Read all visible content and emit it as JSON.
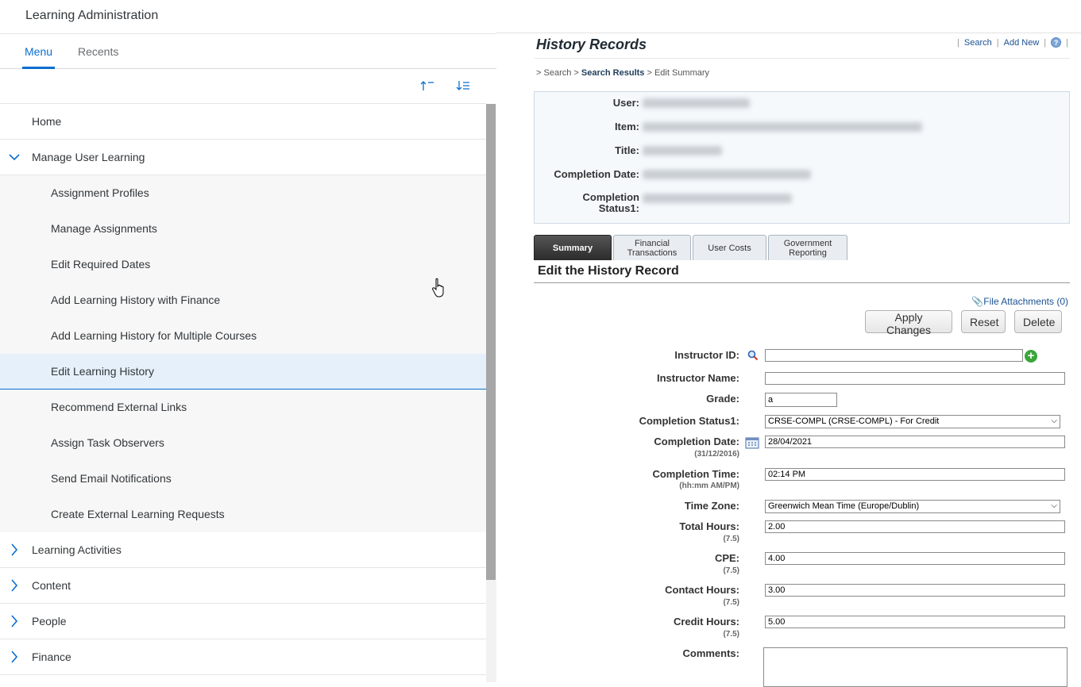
{
  "app": {
    "title": "Learning Administration"
  },
  "tabs": {
    "menu": "Menu",
    "recents": "Recents"
  },
  "toolbar": {
    "sort_asc_icon": "sort-ascending-icon",
    "sort_desc_icon": "sort-descending-icon"
  },
  "menu": {
    "home": "Home",
    "manage_user_learning": "Manage User Learning",
    "sub": [
      "Assignment Profiles",
      "Manage Assignments",
      "Edit Required Dates",
      "Add Learning History with Finance",
      "Add Learning History for Multiple Courses",
      "Edit Learning History",
      "Recommend External Links",
      "Assign Task Observers",
      "Send Email Notifications",
      "Create External Learning Requests"
    ],
    "selected": "Edit Learning History",
    "learning_activities": "Learning Activities",
    "content": "Content",
    "people": "People",
    "finance": "Finance"
  },
  "history": {
    "title": "History Records",
    "links": {
      "search": "Search",
      "add_new": "Add New",
      "help": "?"
    },
    "breadcrumb": {
      "sep": ">",
      "search": "Search",
      "results": "Search Results",
      "current": "Edit Summary"
    },
    "summary": {
      "user_label": "User:",
      "item_label": "Item:",
      "title_label": "Title:",
      "completion_date_label": "Completion Date:",
      "completion_status_label_1": "Completion",
      "completion_status_label_2": "Status1:"
    },
    "tabs": {
      "summary": "Summary",
      "financial_1": "Financial",
      "financial_2": "Transactions",
      "user_costs": "User Costs",
      "government_1": "Government",
      "government_2": "Reporting"
    },
    "section_title": "Edit the History Record",
    "file_attachments": "File Attachments (0)",
    "buttons": {
      "apply": "Apply Changes",
      "reset": "Reset",
      "delete": "Delete"
    },
    "form": {
      "instructor_id_label": "Instructor ID:",
      "instructor_id_value": "",
      "instructor_name_label": "Instructor Name:",
      "instructor_name_value": "",
      "grade_label": "Grade:",
      "grade_value": "a",
      "completion_status_label": "Completion Status1:",
      "completion_status_value": "CRSE-COMPL (CRSE-COMPL) - For Credit",
      "completion_date_label": "Completion Date:",
      "completion_date_hint": "(31/12/2016)",
      "completion_date_value": "28/04/2021",
      "completion_time_label": "Completion Time:",
      "completion_time_hint": "(hh:mm AM/PM)",
      "completion_time_value": "02:14 PM",
      "time_zone_label": "Time Zone:",
      "time_zone_value": "Greenwich Mean Time (Europe/Dublin)",
      "total_hours_label": "Total Hours:",
      "total_hours_hint": "(7.5)",
      "total_hours_value": "2.00",
      "cpe_label": "CPE:",
      "cpe_hint": "(7.5)",
      "cpe_value": "4.00",
      "contact_hours_label": "Contact Hours:",
      "contact_hours_hint": "(7.5)",
      "contact_hours_value": "3.00",
      "credit_hours_label": "Credit Hours:",
      "credit_hours_hint": "(7.5)",
      "credit_hours_value": "5.00",
      "comments_label": "Comments:"
    }
  },
  "colors": {
    "accent": "#0a6ed1",
    "selected_bg": "#e5f0fa",
    "link": "#1a5291"
  }
}
